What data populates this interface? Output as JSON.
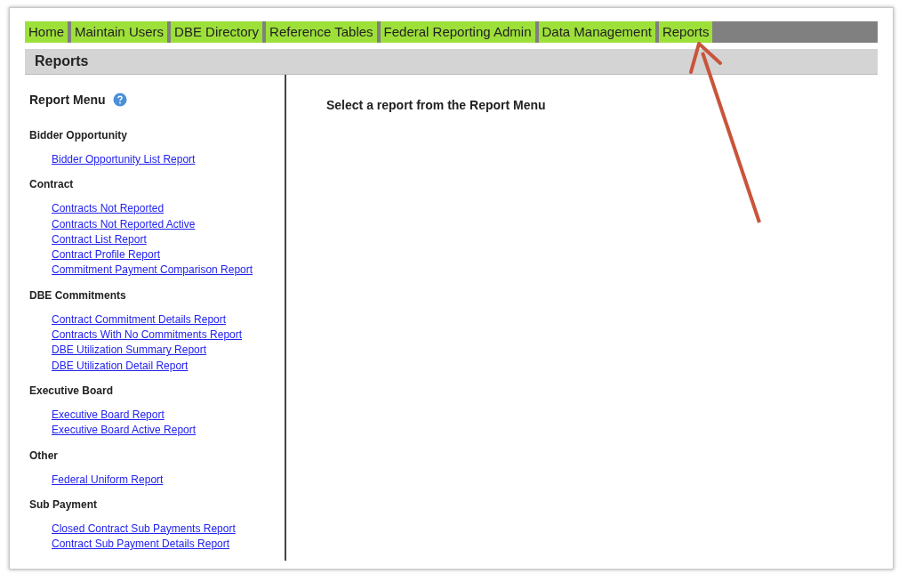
{
  "nav_tabs": [
    {
      "label": "Home"
    },
    {
      "label": "Maintain Users"
    },
    {
      "label": "DBE Directory"
    },
    {
      "label": "Reference Tables"
    },
    {
      "label": "Federal Reporting Admin"
    },
    {
      "label": "Data Management"
    },
    {
      "label": "Reports"
    }
  ],
  "page_title": "Reports",
  "report_menu": {
    "title": "Report Menu",
    "sections": [
      {
        "heading": "Bidder Opportunity",
        "links": [
          "Bidder Opportunity List Report"
        ]
      },
      {
        "heading": "Contract",
        "links": [
          "Contracts Not Reported",
          "Contracts Not Reported Active",
          "Contract List Report",
          "Contract Profile Report",
          "Commitment Payment Comparison Report"
        ]
      },
      {
        "heading": "DBE Commitments",
        "links": [
          "Contract Commitment Details Report",
          "Contracts With No Commitments Report",
          "DBE Utilization Summary Report",
          "DBE Utilization Detail Report"
        ]
      },
      {
        "heading": "Executive Board",
        "links": [
          "Executive Board Report",
          "Executive Board Active Report"
        ]
      },
      {
        "heading": "Other",
        "links": [
          "Federal Uniform Report"
        ]
      },
      {
        "heading": "Sub Payment",
        "links": [
          "Closed Contract Sub Payments Report",
          "Contract Sub Payment Details Report"
        ]
      }
    ]
  },
  "main_message": "Select a report from the Report Menu"
}
